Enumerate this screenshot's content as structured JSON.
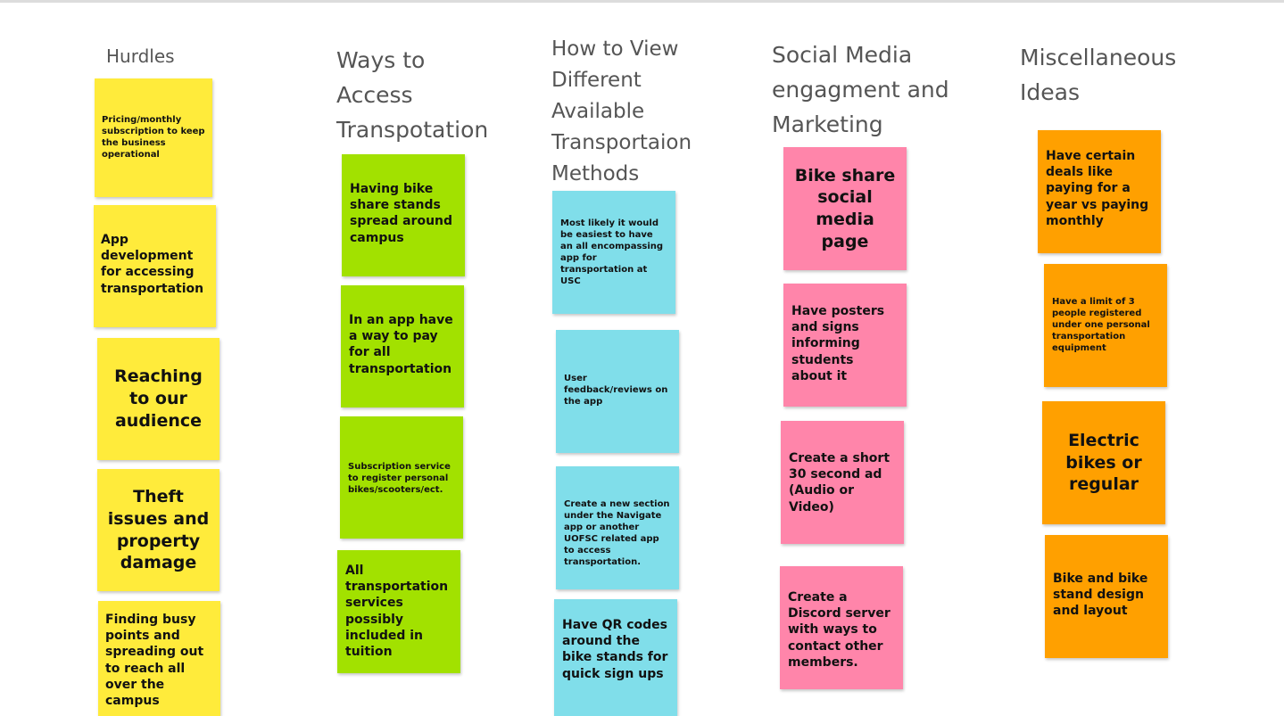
{
  "columns": [
    {
      "title": "Hurdles",
      "notes": [
        "Pricing/monthly subscription to keep the business operational",
        "App development for accessing transportation",
        "Reaching to our audience",
        "Theft issues and property damage",
        "Finding busy points and spreading out to reach all over the campus"
      ]
    },
    {
      "title": "Ways to Access Transpotation",
      "notes": [
        "Having bike share stands spread around campus",
        "In an app have a way to pay for all transportation",
        "Subscription service to register personal bikes/scooters/ect.",
        "All transportation services possibly included in tuition"
      ]
    },
    {
      "title": "How to View Different Available Transportaion Methods",
      "notes": [
        "Most likely it would be easiest to have an all encompassing app for transportation at USC",
        "User feedback/reviews on the app",
        "Create a new section under the Navigate app or another UOFSC related app to access transportation.",
        "Have QR codes around the bike stands for quick sign ups"
      ]
    },
    {
      "title": "Social Media engagment and Marketing",
      "notes": [
        "Bike share social media page",
        "Have posters and signs informing students about it",
        "Create a short 30 second ad (Audio or Video)",
        "Create a Discord server with ways to contact other members."
      ]
    },
    {
      "title": "Miscellaneous Ideas",
      "notes": [
        "Have certain deals like paying for a year vs paying monthly",
        "Have a limit of 3 people registered under one personal transportation equipment",
        "Electric bikes or regular",
        "Bike and bike stand design and layout"
      ]
    }
  ],
  "colors": {
    "yellow": "#ffeb3b",
    "green": "#a2e100",
    "blue": "#80deea",
    "pink": "#ff85aa",
    "orange": "#ffa000"
  }
}
